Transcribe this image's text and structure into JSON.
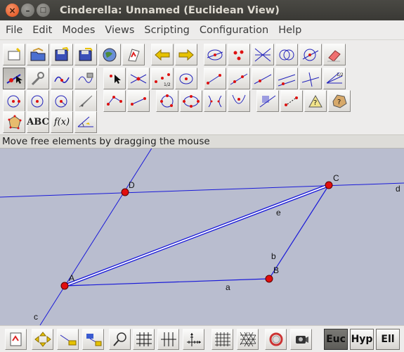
{
  "window": {
    "title": "Cinderella: Unnamed (Euclidean View)",
    "close_glyph": "×",
    "minimize_glyph": "–",
    "maximize_glyph": "□"
  },
  "menu": [
    "File",
    "Edit",
    "Modes",
    "Views",
    "Scripting",
    "Configuration",
    "Help"
  ],
  "toolbar": {
    "text_tool_label": "ABC",
    "function_tool_label": "f(x)"
  },
  "status_text": "Move free elements by dragging the mouse",
  "construction": {
    "points": [
      "A",
      "B",
      "C",
      "D"
    ],
    "segments": [
      "a",
      "b",
      "e"
    ],
    "lines": [
      "c",
      "d"
    ]
  },
  "views": {
    "euclidean": "Euc",
    "hyperbolic": "Hyp",
    "elliptic": "Ell",
    "active": "Euc"
  },
  "colors": {
    "canvas_bg": "#b9bdcf",
    "line": "#1a1ad8",
    "point_fill": "#e10e0e",
    "highlight": "#ffffff",
    "title_bg": "#3c3b37"
  }
}
